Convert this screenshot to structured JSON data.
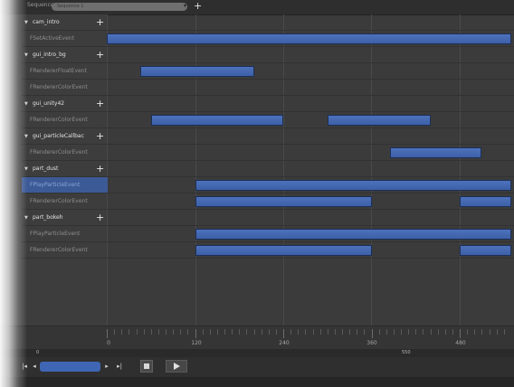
{
  "topbar": {
    "sequence_label": "Sequence",
    "sequence_value": "Sequence 1",
    "add_label": "+"
  },
  "tracks": [
    {
      "kind": "group",
      "label": "cam_intro"
    },
    {
      "kind": "event",
      "label": "FSetActiveEvent"
    },
    {
      "kind": "group",
      "label": "gui_intro_bg"
    },
    {
      "kind": "event",
      "label": "FRendererFloatEvent"
    },
    {
      "kind": "event",
      "label": "FRendererColorEvent"
    },
    {
      "kind": "group",
      "label": "gui_unity42"
    },
    {
      "kind": "event",
      "label": "FRendererColorEvent"
    },
    {
      "kind": "group",
      "label": "gui_particleCallbac"
    },
    {
      "kind": "event",
      "label": "FRendererColorEvent"
    },
    {
      "kind": "group",
      "label": "part_dust"
    },
    {
      "kind": "event",
      "label": "FPlayParticleEvent",
      "selected": true
    },
    {
      "kind": "event",
      "label": "FRendererColorEvent"
    },
    {
      "kind": "group",
      "label": "part_bokeh"
    },
    {
      "kind": "event",
      "label": "FPlayParticleEvent"
    },
    {
      "kind": "event",
      "label": "FRendererColorEvent"
    }
  ],
  "timeline": {
    "tick_labels": [
      "0",
      "120",
      "240",
      "360",
      "480"
    ],
    "range_start": "0",
    "range_end": "550"
  },
  "events": [
    {
      "row": 1,
      "start": 0,
      "end": 550
    },
    {
      "row": 3,
      "start": 45,
      "end": 200
    },
    {
      "row": 6,
      "start": 60,
      "end": 240
    },
    {
      "row": 6,
      "start": 300,
      "end": 440
    },
    {
      "row": 8,
      "start": 385,
      "end": 510
    },
    {
      "row": 10,
      "start": 120,
      "end": 550
    },
    {
      "row": 11,
      "start": 120,
      "end": 360
    },
    {
      "row": 11,
      "start": 480,
      "end": 550
    },
    {
      "row": 13,
      "start": 120,
      "end": 550
    },
    {
      "row": 14,
      "start": 120,
      "end": 360
    },
    {
      "row": 14,
      "start": 480,
      "end": 550
    }
  ],
  "controls": {
    "first_label": "|◂",
    "prev_label": "◂",
    "next_label": "▸",
    "last_label": "▸|",
    "icons": [
      "stop-icon",
      "play-icon"
    ]
  },
  "colors": {
    "event_bar": "#3d5fa6",
    "selection": "#3c5a96",
    "background": "#3b3b3b"
  }
}
